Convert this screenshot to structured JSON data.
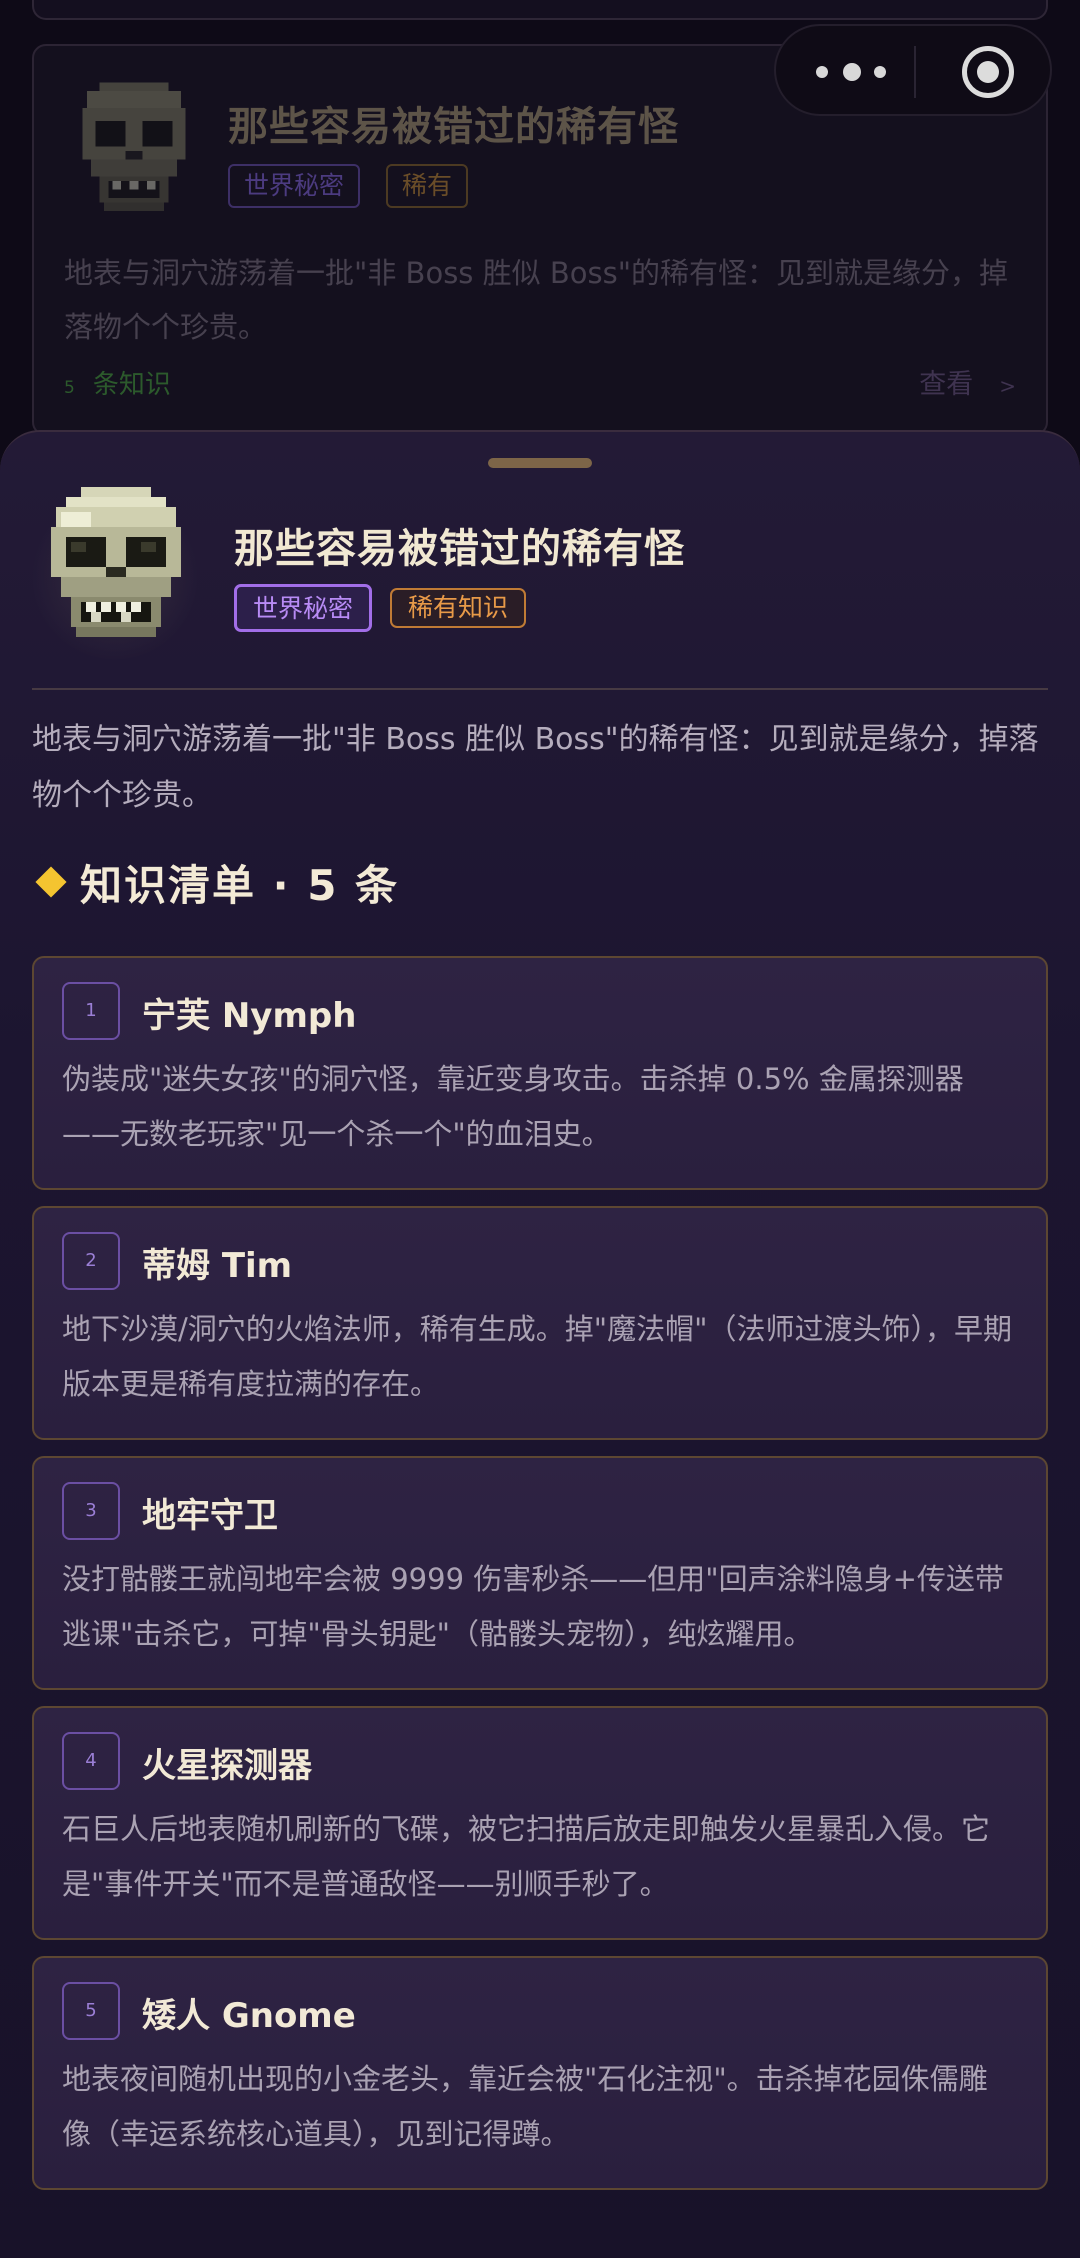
{
  "background_card": {
    "title": "那些容易被错过的稀有怪",
    "tag_world": "世界秘密",
    "tag_rare": "稀有",
    "description": "地表与洞穴游荡着一批\"非 Boss 胜似 Boss\"的稀有怪：见到就是缘分，掉落物个个珍贵。",
    "count_num": "5",
    "count_label": "条知识",
    "view_label": "查看",
    "view_arrow": ">"
  },
  "capsule": {
    "menu_icon": "more-dots-icon",
    "close_icon": "target-close-icon"
  },
  "sheet": {
    "title": "那些容易被错过的稀有怪",
    "tag_world": "世界秘密",
    "tag_rare": "稀有知识",
    "description": "地表与洞穴游荡着一批\"非 Boss 胜似 Boss\"的稀有怪：见到就是缘分，掉落物个个珍贵。",
    "section_title": "知识清单 · 5 条"
  },
  "items": [
    {
      "num": "1",
      "title": "宁芙 Nymph",
      "body": "伪装成\"迷失女孩\"的洞穴怪，靠近变身攻击。击杀掉 0.5% 金属探测器——无数老玩家\"见一个杀一个\"的血泪史。"
    },
    {
      "num": "2",
      "title": "蒂姆 Tim",
      "body": "地下沙漠/洞穴的火焰法师，稀有生成。掉\"魔法帽\"（法师过渡头饰），早期版本更是稀有度拉满的存在。"
    },
    {
      "num": "3",
      "title": "地牢守卫",
      "body": "没打骷髅王就闯地牢会被 9999 伤害秒杀——但用\"回声涂料隐身+传送带逃课\"击杀它，可掉\"骨头钥匙\"（骷髅头宠物），纯炫耀用。"
    },
    {
      "num": "4",
      "title": "火星探测器",
      "body": "石巨人后地表随机刷新的飞碟，被它扫描后放走即触发火星暴乱入侵。它是\"事件开关\"而不是普通敌怪——别顺手秒了。"
    },
    {
      "num": "5",
      "title": "矮人 Gnome",
      "body": "地表夜间随机出现的小金老头，靠近会被\"石化注视\"。击杀掉花园侏儒雕像（幸运系统核心道具），见到记得蹲。"
    }
  ],
  "colors": {
    "accent_purple": "#a26ee8",
    "accent_orange": "#e89a48",
    "diamond_gold": "#f4c430",
    "card_border": "#5d4732"
  }
}
